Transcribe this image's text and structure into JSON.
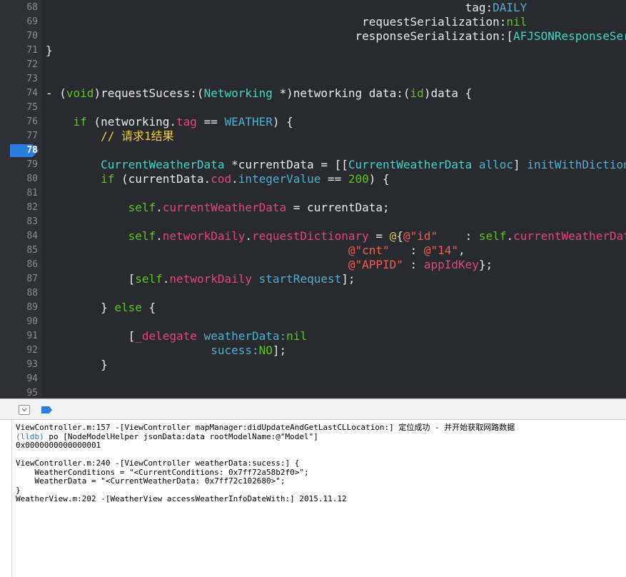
{
  "editor": {
    "breakpoint_line": "78",
    "lines": [
      {
        "n": "68",
        "t": [
          [
            "                                                             tag:",
            ""
          ],
          [
            "DAILY",
            "t-cls"
          ]
        ]
      },
      {
        "n": "69",
        "t": [
          [
            "                                              requestSerialization:",
            ""
          ],
          [
            "nil",
            "t-kwg"
          ]
        ]
      },
      {
        "n": "70",
        "t": [
          [
            "                                             responseSerialization:[",
            ""
          ],
          [
            "AFJSONResponseSerializer",
            "t-typ"
          ]
        ]
      },
      {
        "n": "71",
        "t": [
          [
            "}",
            ""
          ]
        ]
      },
      {
        "n": "72",
        "t": []
      },
      {
        "n": "73",
        "t": []
      },
      {
        "n": "74",
        "t": [
          [
            "- (",
            ""
          ],
          [
            "void",
            "t-kwg"
          ],
          [
            ")requestSucess:(",
            ""
          ],
          [
            "Networking",
            "t-typ"
          ],
          [
            " *)networking data:(",
            ""
          ],
          [
            "id",
            "t-kwg"
          ],
          [
            ")data {",
            ""
          ]
        ]
      },
      {
        "n": "75",
        "t": []
      },
      {
        "n": "76",
        "t": [
          [
            "    ",
            ""
          ],
          [
            "if",
            "t-kwg"
          ],
          [
            " (networking.",
            ""
          ],
          [
            "tag",
            "t-mem"
          ],
          [
            " == ",
            ""
          ],
          [
            "WEATHER",
            "t-cls"
          ],
          [
            ") {",
            ""
          ]
        ]
      },
      {
        "n": "77",
        "t": [
          [
            "        ",
            ""
          ],
          [
            "// 请求1结果",
            "t-cmt"
          ]
        ]
      },
      {
        "n": "78",
        "t": []
      },
      {
        "n": "79",
        "t": [
          [
            "        ",
            ""
          ],
          [
            "CurrentWeatherData",
            "t-typ"
          ],
          [
            " *currentData = [[",
            ""
          ],
          [
            "CurrentWeatherData",
            "t-typ"
          ],
          [
            " ",
            ""
          ],
          [
            "alloc",
            "t-cls"
          ],
          [
            "] ",
            ""
          ],
          [
            "initWithDictionary:",
            "t-cls"
          ]
        ]
      },
      {
        "n": "80",
        "t": [
          [
            "        ",
            ""
          ],
          [
            "if",
            "t-kwg"
          ],
          [
            " (currentData.",
            ""
          ],
          [
            "cod",
            "t-mem"
          ],
          [
            ".",
            ""
          ],
          [
            "integerValue",
            "t-cls"
          ],
          [
            " == ",
            ""
          ],
          [
            "200",
            "t-num"
          ],
          [
            ") {",
            ""
          ]
        ]
      },
      {
        "n": "81",
        "t": []
      },
      {
        "n": "82",
        "t": [
          [
            "            ",
            ""
          ],
          [
            "self",
            "t-kwg"
          ],
          [
            ".",
            ""
          ],
          [
            "currentWeatherData",
            "t-mem"
          ],
          [
            " = currentData;",
            ""
          ]
        ]
      },
      {
        "n": "83",
        "t": []
      },
      {
        "n": "84",
        "t": [
          [
            "            ",
            ""
          ],
          [
            "self",
            "t-kwg"
          ],
          [
            ".",
            ""
          ],
          [
            "networkDaily",
            "t-mem"
          ],
          [
            ".",
            ""
          ],
          [
            "requestDictionary",
            "t-mem"
          ],
          [
            " = ",
            ""
          ],
          [
            "@",
            "t-gold"
          ],
          [
            "{",
            ""
          ],
          [
            "@\"id\"",
            "t-str"
          ],
          [
            "    : ",
            ""
          ],
          [
            "self",
            "t-kwg"
          ],
          [
            ".",
            ""
          ],
          [
            "currentWeatherData",
            "t-mem"
          ]
        ]
      },
      {
        "n": "85",
        "t": [
          [
            "                                            ",
            ""
          ],
          [
            "@\"cnt\"",
            "t-str"
          ],
          [
            "   : ",
            ""
          ],
          [
            "@\"14\"",
            "t-str"
          ],
          [
            ",",
            ""
          ]
        ]
      },
      {
        "n": "86",
        "t": [
          [
            "                                            ",
            ""
          ],
          [
            "@\"APPID\"",
            "t-str"
          ],
          [
            " : ",
            ""
          ],
          [
            "appIdKey",
            "t-mem"
          ],
          [
            "};",
            ""
          ]
        ]
      },
      {
        "n": "87",
        "t": [
          [
            "            [",
            ""
          ],
          [
            "self",
            "t-kwg"
          ],
          [
            ".",
            ""
          ],
          [
            "networkDaily",
            "t-mem"
          ],
          [
            " ",
            ""
          ],
          [
            "startRequest",
            "t-cls"
          ],
          [
            "];",
            ""
          ]
        ]
      },
      {
        "n": "88",
        "t": []
      },
      {
        "n": "89",
        "t": [
          [
            "        } ",
            ""
          ],
          [
            "else",
            "t-kwg"
          ],
          [
            " {",
            ""
          ]
        ]
      },
      {
        "n": "90",
        "t": []
      },
      {
        "n": "91",
        "t": [
          [
            "            [",
            ""
          ],
          [
            "_delegate",
            "t-mem"
          ],
          [
            " ",
            ""
          ],
          [
            "weatherData:",
            "t-cls"
          ],
          [
            "nil",
            "t-kwg"
          ]
        ]
      },
      {
        "n": "92",
        "t": [
          [
            "                        ",
            ""
          ],
          [
            "sucess:",
            "t-cls"
          ],
          [
            "NO",
            "t-kwg"
          ],
          [
            "];",
            ""
          ]
        ]
      },
      {
        "n": "93",
        "t": [
          [
            "        }",
            ""
          ]
        ]
      },
      {
        "n": "94",
        "t": []
      },
      {
        "n": "95",
        "t": []
      }
    ]
  },
  "console": {
    "lines": [
      {
        "text": "ViewController.m:157 -[ViewController mapManager:didUpdateAndGetLastCLLocation:] 定位成功 - 并开始获取网路数据"
      },
      {
        "prefix": "(lldb)",
        "text": " po [NodeModelHelper jsonData:data rootModelName:@\"Model\"]"
      },
      {
        "text": "0x0000000000000001"
      },
      {
        "text": ""
      },
      {
        "text": "ViewController.m:240 -[ViewController weatherData:sucess:] {"
      },
      {
        "text": "    WeatherConditions = \"<CurrentConditions: 0x7ff72a58b2f0>\";"
      },
      {
        "text": "    WeatherData = \"<CurrentWeatherData: 0x7ff72c102680>\";"
      },
      {
        "text": "}"
      },
      {
        "text": "WeatherView.m:202 -[WeatherView accessWeatherInfoDateWith:] 2015.11.12"
      }
    ]
  },
  "colors": {
    "editor_bg": "#292a2f",
    "breakpoint": "#2b7de0",
    "keyword": "#5ec31b",
    "type": "#3ed6c6",
    "member": "#e0467b",
    "string": "#f25d4e"
  },
  "icons": {
    "hide_debug": "hide-debug-area-icon",
    "breakpoint_toggle": "breakpoint-toggle-icon"
  }
}
